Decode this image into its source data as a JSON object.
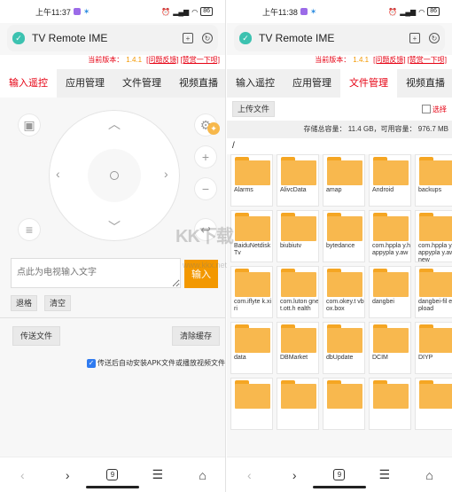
{
  "left": {
    "status": {
      "time": "上午11:37",
      "battery": "86"
    },
    "url_title": "TV Remote IME",
    "version": {
      "label": "当前版本：",
      "number": "1.4.1",
      "feedback": "[问题反馈]",
      "donate": "[赞赏一下呗]"
    },
    "tabs": [
      "输入遥控",
      "应用管理",
      "文件管理",
      "视频直播"
    ],
    "active_tab": 0,
    "text_input_placeholder": "点此为电视输入文字",
    "send_label": "输入",
    "back_label": "退格",
    "clear_label": "清空",
    "transfer_label": "传送文件",
    "clear_cache_label": "清除缓存",
    "auto_install_label": "传送后自动安装APK文件或播放视频文件"
  },
  "right": {
    "status": {
      "time": "上午11:38",
      "battery": "86"
    },
    "url_title": "TV Remote IME",
    "version": {
      "label": "当前版本：",
      "number": "1.4.1",
      "feedback": "[问题反馈]",
      "donate": "[赞赏一下呗]"
    },
    "tabs": [
      "输入遥控",
      "应用管理",
      "文件管理",
      "视频直播"
    ],
    "active_tab": 2,
    "upload_label": "上传文件",
    "select_label": "选择",
    "storage_text": "存储总容量： 11.4 GB，可用容量： 976.7 MB",
    "path": "/",
    "files": [
      "Alarms",
      "AlivcData",
      "amap",
      "Android",
      "backups",
      "BaiduNetdiskTv",
      "biubiutv",
      "bytedance",
      "com.hppla y.happypla y.aw",
      "com.hppla y.happypla y.aw.new",
      "com.iflyte k.xiri",
      "com.luton gnet.ott.h ealth",
      "com.okey.t vbox.box",
      "dangbei",
      "dangbei-fil eupload",
      "data",
      "DBMarket",
      "dbUpdate",
      "DCIM",
      "DIYP",
      "",
      "",
      "",
      "",
      ""
    ]
  },
  "nav": {
    "tab_count": "9"
  },
  "watermark": {
    "big": "KK下载",
    "small": "www.kkx.net"
  },
  "colors": {
    "accent": "#e60012",
    "orange": "#f39800",
    "folder": "#f8b84e",
    "check": "#2f7bf0"
  }
}
